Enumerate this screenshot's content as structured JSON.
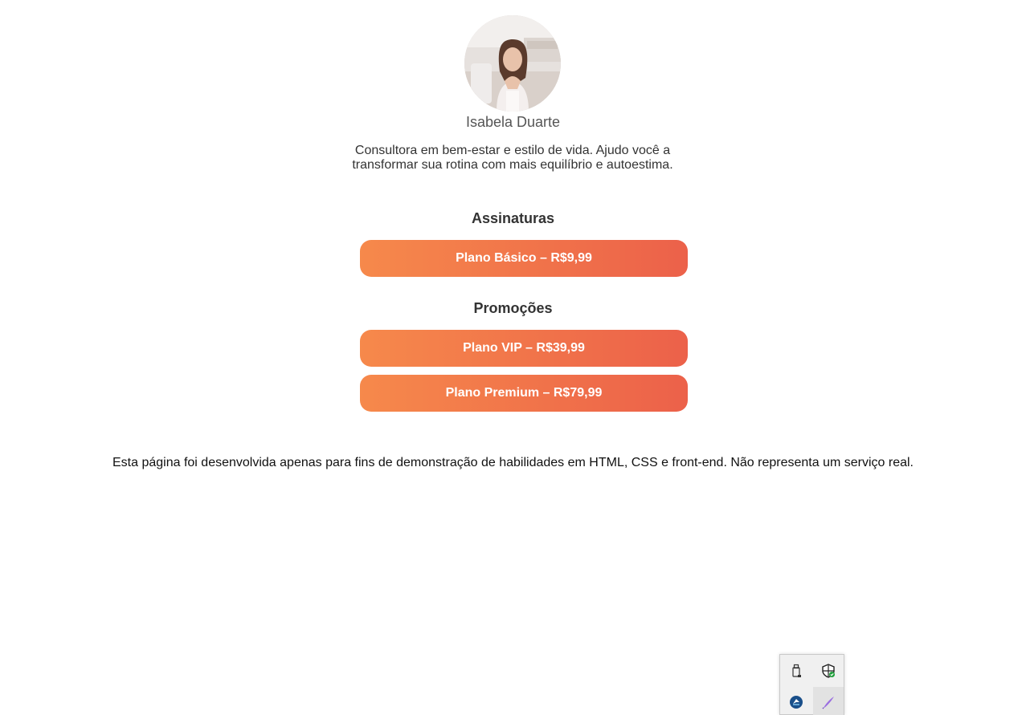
{
  "profile": {
    "name": "Isabela Duarte",
    "bio": "Consultora em bem-estar e estilo de vida. Ajudo você a transformar sua rotina com mais equilíbrio e autoestima.",
    "avatar_icon": "profile-photo"
  },
  "subscriptions": {
    "title": "Assinaturas",
    "plans": [
      {
        "label": "Plano Básico – R$9,99"
      }
    ]
  },
  "promotions": {
    "title": "Promoções",
    "plans": [
      {
        "label": "Plano VIP – R$39,99"
      },
      {
        "label": "Plano Premium – R$79,99"
      }
    ]
  },
  "footer": {
    "disclaimer": "Esta página foi desenvolvida apenas para fins de demonstração de habilidades em HTML, CSS e front-end. Não representa um serviço real."
  },
  "system_tray": {
    "icons": [
      "usb-drive-icon",
      "security-shield-icon",
      "app-logo-icon",
      "pen-icon"
    ]
  },
  "colors": {
    "button_gradient_start": "#f6894b",
    "button_gradient_end": "#ec614a",
    "button_text": "#ffffff"
  }
}
